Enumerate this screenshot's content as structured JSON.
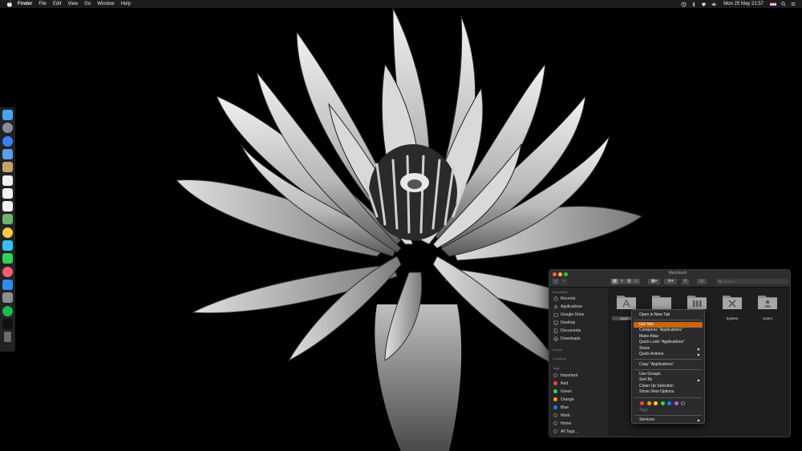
{
  "menubar": {
    "app": "Finder",
    "items": [
      "File",
      "Edit",
      "View",
      "Go",
      "Window",
      "Help"
    ],
    "clock": "Mon 25 May  21:57",
    "icons": [
      "apple-icon",
      "time-machine-icon",
      "bluetooth-icon",
      "wifi-icon",
      "volume-icon",
      "flag-icon",
      "search-icon",
      "menu-list-icon"
    ]
  },
  "dock": {
    "icons": [
      "finder",
      "launchpad",
      "safari",
      "mail",
      "notes",
      "calendar",
      "reminders",
      "text-edit",
      "maps",
      "photos",
      "messages",
      "facetime",
      "music",
      "app-store",
      "system-preferences",
      "spotify",
      "terminal",
      "trash"
    ],
    "colors": [
      "#4aa3f0",
      "#8a8a9a",
      "#3b82f6",
      "#5aa0e8",
      "#c7a36a",
      "#f2f2f2",
      "#f2f2f2",
      "#f2f2f2",
      "#6db26d",
      "#f7c948",
      "#38bdf8",
      "#34d058",
      "#fb5c74",
      "#2f8cf0",
      "#8e8e93",
      "#1db954",
      "#111111",
      "#6b6b6b"
    ]
  },
  "finder": {
    "title": "Macintosh",
    "search_placeholder": "Search",
    "sidebar": {
      "favorites_header": "Favourites",
      "favorites": [
        "Recents",
        "Applications",
        "Google Drive",
        "Desktop",
        "Documents",
        "Downloads"
      ],
      "icloud_header": "iCloud",
      "locations_header": "Locations",
      "tags_header": "Tags",
      "tags": [
        {
          "label": "Important",
          "color": "#555555"
        },
        {
          "label": "Red",
          "color": "#ff453a"
        },
        {
          "label": "Green",
          "color": "#32d74b"
        },
        {
          "label": "Orange",
          "color": "#ff9f0a"
        },
        {
          "label": "Blue",
          "color": "#0a84ff"
        },
        {
          "label": "Work",
          "color": "#555555"
        },
        {
          "label": "Home",
          "color": "#555555"
        },
        {
          "label": "All Tags...",
          "color": "#555555"
        }
      ]
    },
    "items": [
      {
        "label": "Applications",
        "short": "Applicat",
        "icon": "applications-folder-icon"
      },
      {
        "label": "",
        "icon": "folder-icon"
      },
      {
        "label": "",
        "icon": "library-folder-icon"
      },
      {
        "label": "System",
        "icon": "system-folder-icon"
      },
      {
        "label": "Users",
        "icon": "users-folder-icon"
      }
    ]
  },
  "context_menu": {
    "items": [
      {
        "label": "Open in New Tab"
      },
      {
        "label": "Get Info",
        "active": true
      },
      {
        "label": "Compress “Applications”"
      },
      {
        "label": "Make Alias"
      },
      {
        "label": "Quick Look “Applications”"
      },
      {
        "label": "Share",
        "submenu": true
      },
      {
        "label": "Quick Actions",
        "submenu": true
      },
      {
        "label": "Copy “Applications”"
      },
      {
        "label": "Use Groups"
      },
      {
        "label": "Sort By",
        "submenu": true
      },
      {
        "label": "Clean Up Selection"
      },
      {
        "label": "Show View Options"
      },
      {
        "label": "Tags..."
      },
      {
        "label": "Services",
        "submenu": true
      }
    ],
    "tag_colors": [
      "#ff453a",
      "#ff9f0a",
      "#ffd60a",
      "#32d74b",
      "#0a84ff",
      "#bf5af2",
      "#8e8e93"
    ],
    "submenu_arrow": "▶"
  }
}
